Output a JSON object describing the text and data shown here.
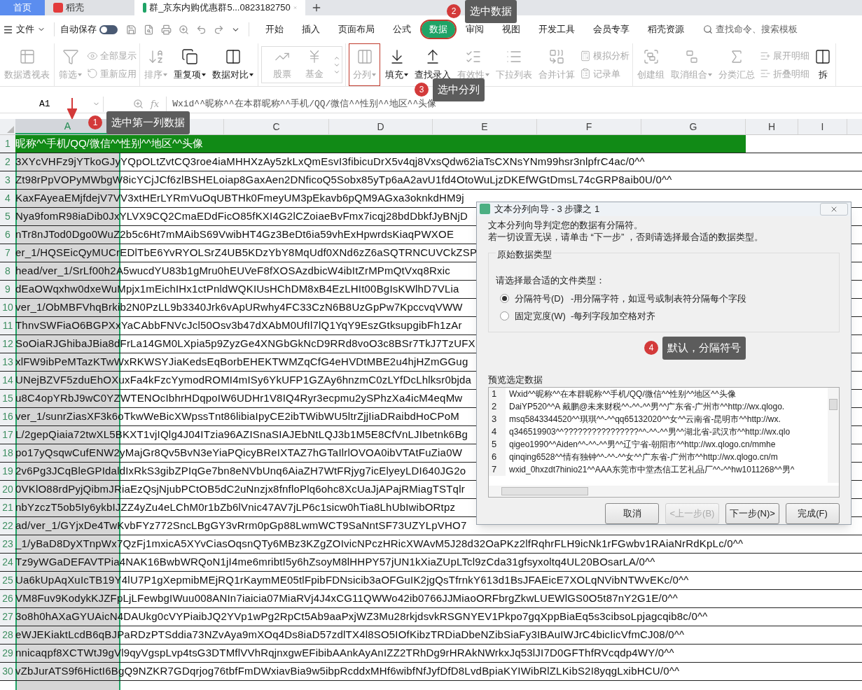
{
  "tabs": [
    {
      "label": "首页",
      "selected": false,
      "kind": "home"
    },
    {
      "label": "稻壳",
      "selected": false,
      "kind": "docer"
    },
    {
      "label": "群_京东内购优惠群5...0823182750",
      "selected": true,
      "kind": "sheet"
    }
  ],
  "menu": {
    "file": "文件",
    "autosave": {
      "label": "自动保存",
      "on": false
    },
    "tabs": [
      {
        "label": "开始",
        "selected": false
      },
      {
        "label": "插入",
        "selected": false
      },
      {
        "label": "页面布局",
        "selected": false
      },
      {
        "label": "公式",
        "selected": false
      },
      {
        "label": "数据",
        "selected": true
      },
      {
        "label": "审阅",
        "selected": false
      },
      {
        "label": "视图",
        "selected": false
      },
      {
        "label": "开发工具",
        "selected": false
      },
      {
        "label": "会员专享",
        "selected": false
      },
      {
        "label": "稻壳资源",
        "selected": false
      }
    ],
    "search": {
      "placeholder": "查找命令、搜索模板"
    }
  },
  "ribbon": [
    {
      "items": [
        {
          "kind": "large",
          "label": "数据透视表",
          "disabled": true,
          "dropdown": false
        }
      ]
    },
    {
      "items": [
        {
          "kind": "large",
          "label": "筛选",
          "disabled": true,
          "dropdown": true
        },
        {
          "kind": "stack",
          "items": [
            {
              "label": "全部显示",
              "disabled": true
            },
            {
              "label": "重新应用",
              "disabled": true
            }
          ]
        }
      ]
    },
    {
      "items": [
        {
          "kind": "large",
          "label": "排序",
          "disabled": true,
          "dropdown": true
        },
        {
          "kind": "large",
          "label": "重复项",
          "disabled": false,
          "dropdown": true
        },
        {
          "kind": "large",
          "label": "数据对比",
          "disabled": false,
          "dropdown": true
        }
      ]
    },
    {
      "items": [
        {
          "kind": "gallery",
          "items": [
            {
              "label": "股票",
              "disabled": true
            },
            {
              "label": "基金",
              "disabled": true
            }
          ]
        }
      ]
    },
    {
      "items": [
        {
          "kind": "large",
          "label": "分列",
          "disabled": true,
          "dropdown": true,
          "marked": true
        },
        {
          "kind": "large",
          "label": "填充",
          "disabled": false,
          "dropdown": true
        },
        {
          "kind": "large",
          "label": "查找录入",
          "disabled": false,
          "dropdown": false
        },
        {
          "kind": "large",
          "label": "有效性",
          "disabled": true,
          "dropdown": true
        },
        {
          "kind": "large",
          "label": "下拉列表",
          "disabled": true,
          "dropdown": false
        },
        {
          "kind": "large",
          "label": "合并计算",
          "disabled": true,
          "dropdown": false
        },
        {
          "kind": "stack",
          "items": [
            {
              "label": "模拟分析",
              "disabled": true
            },
            {
              "label": "记录单",
              "disabled": true
            }
          ]
        }
      ]
    },
    {
      "items": [
        {
          "kind": "large",
          "label": "创建组",
          "disabled": true,
          "dropdown": false
        },
        {
          "kind": "large",
          "label": "取消组合",
          "disabled": true,
          "dropdown": true
        },
        {
          "kind": "large",
          "label": "分类汇总",
          "disabled": true,
          "dropdown": false
        },
        {
          "kind": "stack",
          "items": [
            {
              "label": "展开明细",
              "disabled": true
            },
            {
              "label": "折叠明细",
              "disabled": true
            }
          ]
        },
        {
          "kind": "large",
          "label": "拆",
          "disabled": false,
          "dropdown": false
        }
      ]
    }
  ],
  "formula_bar": {
    "name_box": "A1",
    "fx": "fx",
    "formula": "Wxid^^昵称^^在本群昵称^^手机/QQ/微信^^性别^^地区^^头像"
  },
  "columns": [
    {
      "label": "A",
      "selected": true
    },
    {
      "selected": false
    },
    {
      "label": "C",
      "selected": false
    },
    {
      "label": "D",
      "selected": false
    },
    {
      "label": "E",
      "selected": false
    },
    {
      "label": "F",
      "selected": false
    },
    {
      "label": "G",
      "selected": false
    },
    {
      "label": "H",
      "selected": false
    },
    {
      "label": "I",
      "selected": false
    }
  ],
  "rows": [
    {
      "number": "1",
      "kind": "header",
      "text": "昵称^^手机/QQ/微信^^性别^^地区^^头像"
    },
    {
      "number": "2",
      "kind": "data",
      "text": "3XYcVHFz9jYTkoGJyYQpOLtZvtCQ3roe4iaMHHXzAy5zkLxQmEsvI3fibicuDrX5v4qj8VxsQdw62iaTsCXNsYNm99hsr3nlpfrC4ac/0^^"
    },
    {
      "number": "3",
      "kind": "data",
      "text": "Zt98rPpVOPyMWbgW8icYCjJCf6zlBSHELoiap8GaxAen2DNficoQ5Sobx85yTp6aA2avU1fd4OtoWuLjzDKEfWGtDmsL74cGRP8aib0U/0^^"
    },
    {
      "number": "4",
      "kind": "data",
      "text": "KaxFAyeaEMjfdejV7VV3xtHErLYRmVuOqUBTHk0FmeyUM3pEkavb6pQM9AGxa3oknkdHM9j"
    },
    {
      "number": "5",
      "kind": "data",
      "text": "Nya9fomR98iaDib0JxYLVX9CQ2CmaEDdFicO85fKXI4G2lCZoiaeBvFmx7icqj28bdDbkfJyBNjD"
    },
    {
      "number": "6",
      "kind": "data",
      "text": "nTr8nJTod0Dgo0WuZ2b5c6Ht7mMAibS69VwibHT4Gz3BeDt6ia59vhExHpwrdsKiaqPWXOE"
    },
    {
      "number": "7",
      "kind": "data",
      "text": "er_1/HQSEicQyMUCrEDlTbE6YvRYOLSrZ4UB5KDzYbY8MqUdf0XNd6zZ6aSQTRNCUVCkZSP"
    },
    {
      "number": "8",
      "kind": "data",
      "text": "head/ver_1/SrLf00h2A5wucdYU83b1gMru0hEUVeF8fXOSAzdbicW4ibItZrMPmQtVxq8Rxic"
    },
    {
      "number": "9",
      "kind": "data",
      "text": "dEaOWqxhw0dxeWuMpjx1mEichIHx1ctPnldWQKIUsHChDM8xB4EzLHIt00BgIsKWlhD7VLia"
    },
    {
      "number": "10",
      "kind": "data",
      "text": "ver_1/ObMBFVhqBrkib2N0PzLL9b3340Jrk6vApURwhy4FC33CzN6B8UzGpPw7KpccvqVWW"
    },
    {
      "number": "11",
      "kind": "data",
      "text": "ThnvSWFiaO6BGPXxYaCAbbFNVcJcl50Osv3b47dXAbM0UfIl7lQ1YqY9EszGtksupgibFh1zAr"
    },
    {
      "number": "12",
      "kind": "data",
      "text": "SoOiaRJGhibaJBia8dFrLa14GM0LXpia5p9ZyzGe4XNGbGkNcD9RRd8voO3c8BSr7TkJ7TzUFX"
    },
    {
      "number": "13",
      "kind": "data",
      "text": "xlFW9ibPeMTazKTwWxRKWSYJiaKedsEqBorbEHEKTWMZqCfG4eHVDtMBE2u4hjHZmGGug"
    },
    {
      "number": "14",
      "kind": "data",
      "text": "UNejBZVF5zduEhOXuxFa4kFzcYymodROMI4mISy6YkUFP1GZAy6hnzmC0zLYfDcLhlksr0bjda"
    },
    {
      "number": "15",
      "kind": "data",
      "text": "u8C4opYRbJ9wC0YZWTENOcIbhrHDqpoIW6UDHr1V8IQ4Ryr3ecpmu2ySPhzXa4icM4eqMw"
    },
    {
      "number": "16",
      "kind": "data",
      "text": "ver_1/sunrZiasXF3k6oTkwWeBicXWpssTnt86libiaIpyCE2ibTWibWU5ltrZjjIiaDRaibdHoCPoM"
    },
    {
      "number": "17",
      "kind": "data",
      "text": "L/2gepQiaia72twXL5BKXT1vjIQlg4J04ITzia96AZISnaSIAJEbNtLQJ3b1M5E8CfVnLJIbetnk6Bg"
    },
    {
      "number": "18",
      "kind": "data",
      "text": "po17yQsqwCufENW2yMajGr8Qv5BvN3eYiaPQicyBReIXTAZ7hGTaIlrlOVOA0ibVTAtFuZia0W"
    },
    {
      "number": "19",
      "kind": "data",
      "text": "2v6Pg3JCqBleGPIdaldIxRkS3gibZPIqGe7bn8eNVbUnq6AiaZH7WtFRjyg7icElyeyLDI640JG2o"
    },
    {
      "number": "20",
      "kind": "data",
      "text": "0VKlO88rdPyjQibmJRiaEzQsjNjubPCtOB5dC2uNnzjx8fnfloPlq6ohc8XcUaJjAPajRMiagTSTqlr"
    },
    {
      "number": "21",
      "kind": "data",
      "text": "nbYzczT5ob5Iy6ykbIJZZ4yZu4eLChM0r1bZb6lVnic47AV7jLP6c1sicw0hTia8LhUbIwibORtpz"
    },
    {
      "number": "22",
      "kind": "data",
      "text": "ad/ver_1/GYjxDe4TwKvbFYz772SncLBgGY3vRrm0pGp88LwmWCT9SaNntSF73UZYLpVHO7"
    },
    {
      "number": "23",
      "kind": "data",
      "text": "_1/yBaD8DyXTnpWx7QzFj1mxicA5XYvCiasOqsnQTy6MBz3KZgZOIvicNPczHRicXWAvM5J28d32OaPKz2lfRqhrFLH9icNk1rFGwbv1RAiaNrRdKpLc/0^^"
    },
    {
      "number": "24",
      "kind": "data",
      "text": "Tz9yWGaDEFAVTPia4NAK16BwbWRQoN1jI4me6mribtI5y6hZsoyM8lHHPY57jUN1kXiaZUpLTcl9zCda31gfsyxoltq4UL20BOsarLA/0^^"
    },
    {
      "number": "25",
      "kind": "data",
      "text": "Ua6kUpAqXuIcTB19Y4lU7P1gXepmibMEjRQ1rKaymME05tlFpibFDNsicib3aOFGuIK2jgQsTfrnkY613d1BsJFAEicE7XOLqNVibNTWvEKc/0^^"
    },
    {
      "number": "26",
      "kind": "data",
      "text": "VM8Fuv9KodykKJZFpLjLFewbgIWuu008ANIn7iaicia07MiaRVj4J4xCG11QWWo42ib0766JJMiaoORFbrgZkwLUEWlGS0O5t87nY2G1E/0^^"
    },
    {
      "number": "27",
      "kind": "data",
      "text": "3o8h0hAXaGYUAicN4DAUkg0cVYPiaibJQ2YVp1wPg2RpCt5Ab9aaPxjWZ3Mu28rkjdsvkRSGNYEV1Pkpo7gqXppBiaEq5s3cibsoLpjagcqib8c/0^^"
    },
    {
      "number": "28",
      "kind": "data",
      "text": "eWJEKiaktLcdB6qBJPaRDzPTSddia73NZvAya9mXOq4Ds8iaD57zdlTX4l8SO5IOfKibzTRDiaDbeNZibSiaFy3IBAuIWJrC4bicIicVfmCJ08/0^^"
    },
    {
      "number": "29",
      "kind": "data",
      "text": "nnicaqpf8XCTWtJ9gVl9qyVgspLvp4tsG3DTMflVVhRqjnxgwEFibibAAnkAyAnIZZ2TRhDg9rHRAkNWrkxJq53lJI7D0GFThfRVcqdp4WY/0^^"
    },
    {
      "number": "30",
      "kind": "data",
      "text": "vZbJurATS9f6HictI6BgQ9NZKR7GDqrjog76tbfFmDWxiavBia9w5ibpRcddxMHf6wibfNfJyfDfD8LvdBpiaKYIWibRlZLKibS2I8yqgLxibHCU/0^^"
    }
  ],
  "dialog": {
    "title": "文本分列向导 - 3 步骤之 1",
    "intro": [
      "文本分列向导判定您的数据有分隔符。",
      "若一切设置无误，请单击 “下一步” ，否则请选择最合适的数据类型。"
    ],
    "group_title": "原始数据类型",
    "prompt": "请选择最合适的文件类型：",
    "options": [
      {
        "label": "分隔符号(D)",
        "description": "-用分隔字符，如逗号或制表符分隔每个字段",
        "selected": true
      },
      {
        "label": "固定宽度(W)",
        "description": "-每列字段加空格对齐",
        "selected": false
      }
    ],
    "preview_title": "预览选定数据",
    "preview": [
      {
        "number": "1",
        "text": "Wxid^^昵称^^在本群昵称^^手机/QQ/微信^^性别^^地区^^头像"
      },
      {
        "number": "2",
        "text": "DaiYP520^^A 戴鹏@未来财税^^-^^-^^男^^广东省-广州市^^http://wx.qlogo."
      },
      {
        "number": "3",
        "text": "msq5843344520^^琪琪^^-^^qq65132020^^女^^云南省-昆明市^^http://wx."
      },
      {
        "number": "4",
        "text": "q346519903^^????????????????^^-^^-^^男^^湖北省-武汉市^^http://wx.qlo"
      },
      {
        "number": "5",
        "text": "qigeo1990^^Aiden^^-^^-^^男^^辽宁省-朝阳市^^http://wx.qlogo.cn/mmhe"
      },
      {
        "number": "6",
        "text": "qinqing6528^^情有独钟^^-^^-^^女^^广东省-广州市^^http://wx.qlogo.cn/m"
      },
      {
        "number": "7",
        "text": "wxid_0hxzdt7hinio21^^AAA东莞市中堂杰信工艺礼品厂^^-^^hw1011268^^男^"
      }
    ],
    "buttons": [
      {
        "label": "取消",
        "disabled": false
      },
      {
        "label": "<上一步(B)",
        "disabled": true
      },
      {
        "label": "下一步(N)>",
        "disabled": false
      },
      {
        "label": "完成(F)",
        "disabled": false
      }
    ]
  },
  "annotations": [
    {
      "number": "1",
      "text": "选中第一列数据"
    },
    {
      "number": "2",
      "text": "选中数据"
    },
    {
      "number": "3",
      "text": "选中分列"
    },
    {
      "number": "4",
      "text": "默认，分隔符号"
    }
  ]
}
